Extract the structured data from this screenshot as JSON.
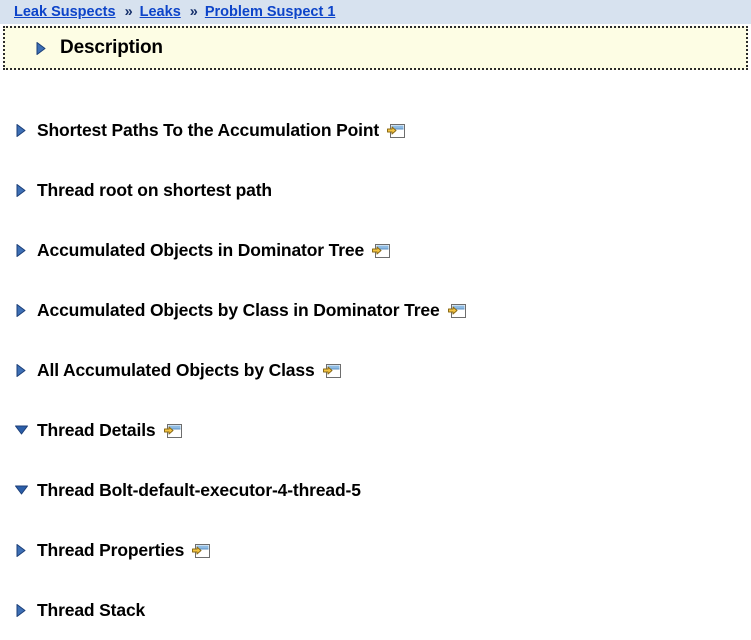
{
  "breadcrumb": {
    "separator": "»",
    "items": [
      {
        "label": "Leak Suspects"
      },
      {
        "label": "Leaks"
      },
      {
        "label": "Problem Suspect 1"
      }
    ]
  },
  "description_panel": {
    "title": "Description",
    "expanded": false,
    "twisty_icon": "triangle-right-icon",
    "background_color": "#fdfde4",
    "border_color": "#2b2b2b"
  },
  "colors": {
    "breadcrumb_background": "#d7e2ef",
    "link": "#0d44c9",
    "separator": "#16306b",
    "twisty": "#1c4f9c",
    "page_background": "#ffffff",
    "heading": "#000000",
    "icon_arrow": "#f0b323",
    "icon_window_titlebar": "#6fa8dc"
  },
  "sections": [
    {
      "title": "Shortest Paths To the Accumulation Point",
      "expanded": false,
      "twisty_icon": "triangle-right-icon",
      "has_pane_icon": true,
      "pane_icon": "open-in-pane-icon"
    },
    {
      "title": "Thread root on shortest path",
      "expanded": false,
      "twisty_icon": "triangle-right-icon",
      "has_pane_icon": false,
      "pane_icon": ""
    },
    {
      "title": "Accumulated Objects in Dominator Tree",
      "expanded": false,
      "twisty_icon": "triangle-right-icon",
      "has_pane_icon": true,
      "pane_icon": "open-in-pane-icon"
    },
    {
      "title": "Accumulated Objects by Class in Dominator Tree",
      "expanded": false,
      "twisty_icon": "triangle-right-icon",
      "has_pane_icon": true,
      "pane_icon": "open-in-pane-icon"
    },
    {
      "title": "All Accumulated Objects by Class",
      "expanded": false,
      "twisty_icon": "triangle-right-icon",
      "has_pane_icon": true,
      "pane_icon": "open-in-pane-icon"
    },
    {
      "title": "Thread Details",
      "expanded": true,
      "twisty_icon": "triangle-down-icon",
      "has_pane_icon": true,
      "pane_icon": "open-in-pane-icon"
    },
    {
      "title": "Thread Bolt-default-executor-4-thread-5",
      "expanded": true,
      "twisty_icon": "triangle-down-icon",
      "has_pane_icon": false,
      "pane_icon": ""
    },
    {
      "title": "Thread Properties",
      "expanded": false,
      "twisty_icon": "triangle-right-icon",
      "has_pane_icon": true,
      "pane_icon": "open-in-pane-icon"
    },
    {
      "title": "Thread Stack",
      "expanded": false,
      "twisty_icon": "triangle-right-icon",
      "has_pane_icon": false,
      "pane_icon": ""
    }
  ]
}
